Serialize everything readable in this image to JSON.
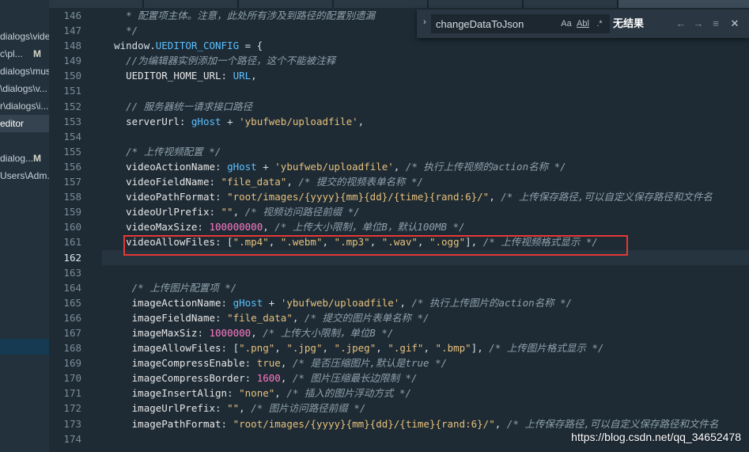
{
  "sidebar": {
    "items": [
      {
        "label": "dialogs\\video",
        "mod": ""
      },
      {
        "label": "c\\pl...",
        "mod": "M"
      },
      {
        "label": "dialogs\\music",
        "mod": ""
      },
      {
        "label": "\\dialogs\\v...",
        "mod": ""
      },
      {
        "label": "r\\dialogs\\i...",
        "mod": ""
      },
      {
        "label": "editor",
        "mod": ""
      },
      {
        "label": "",
        "mod": ""
      },
      {
        "label": "dialog...",
        "mod": "M"
      },
      {
        "label": "Users\\Adm...",
        "mod": ""
      }
    ]
  },
  "find": {
    "query": "changeDataToJson",
    "opt_case": "Aa",
    "opt_word": "Abl",
    "opt_regex": ".*",
    "result": "无结果",
    "prev": "←",
    "next": "→",
    "selection": "≡",
    "close": "✕",
    "toggle": "›"
  },
  "editor": {
    "line_numbers": [
      "146",
      "147",
      "148",
      "149",
      "150",
      "151",
      "152",
      "153",
      "154",
      "155",
      "156",
      "157",
      "158",
      "159",
      "160",
      "161",
      "162",
      "163",
      "164",
      "165",
      "166",
      "167",
      "168",
      "169",
      "170",
      "171",
      "172",
      "173",
      "174"
    ],
    "current_line": "162"
  },
  "code": {
    "l146": "* 配置项主体。注意，此处所有涉及到路径的配置别遗漏",
    "l147": "*/",
    "l148a": "window.",
    "l148b": "UEDITOR_CONFIG",
    "l148c": " = {",
    "l149": "//为编辑器实例添加一个路径，这个不能被注释",
    "l150a": "UEDITOR_HOME_URL",
    "l150b": ": ",
    "l150c": "URL",
    "l150d": ",",
    "l152": "// 服务器统一请求接口路径",
    "l153a": "serverUrl",
    "l153b": ": ",
    "l153c": "gHost",
    "l153d": " + ",
    "l153e": "'ybufweb/uploadfile'",
    "l153f": ",",
    "l155": "/* 上传视频配置 */",
    "l156a": "videoActionName",
    "l156b": ": ",
    "l156c": "gHost",
    "l156d": " + ",
    "l156e": "'ybufweb/uploadfile'",
    "l156f": ", ",
    "l156g": "/* 执行上传视频的action名称 */",
    "l157a": "videoFieldName",
    "l157b": ": ",
    "l157c": "\"file_data\"",
    "l157d": ", ",
    "l157e": "/* 提交的视频表单名称 */",
    "l158a": "videoPathFormat",
    "l158b": ": ",
    "l158c": "\"root/images/{yyyy}{mm}{dd}/{time}{rand:6}/\"",
    "l158d": ", ",
    "l158e": "/* 上传保存路径,可以自定义保存路径和文件名",
    "l159a": "videoUrlPrefix",
    "l159b": ": ",
    "l159c": "\"\"",
    "l159d": ", ",
    "l159e": "/* 视频访问路径前缀 */",
    "l160a": "videoMaxSize",
    "l160b": ": ",
    "l160c": "100000000",
    "l160d": ", ",
    "l160e": "/* 上传大小限制，单位B，默认100MB */",
    "l161a": "videoAllowFiles",
    "l161b": ": [",
    "l161c": "\".mp4\"",
    "l161d": ", ",
    "l161e": "\".webm\"",
    "l161f": ", ",
    "l161g": "\".mp3\"",
    "l161h": ", ",
    "l161i": "\".wav\"",
    "l161j": ", ",
    "l161k": "\".ogg\"",
    "l161l": "], ",
    "l161m": "/* 上传视频格式显示 */",
    "l164": "/* 上传图片配置项 */",
    "l165a": "imageActionName",
    "l165b": ": ",
    "l165c": "gHost",
    "l165d": " + ",
    "l165e": "'ybufweb/uploadfile'",
    "l165f": ", ",
    "l165g": "/* 执行上传图片的action名称 */",
    "l166a": "imageFieldName",
    "l166b": ": ",
    "l166c": "\"file_data\"",
    "l166d": ", ",
    "l166e": "/* 提交的图片表单名称 */",
    "l167a": "imageMaxSiz",
    "l167b": ": ",
    "l167c": "1000000",
    "l167d": ", ",
    "l167e": "/* 上传大小限制，单位B */",
    "l168a": "imageAllowFiles",
    "l168b": ": [",
    "l168c": "\".png\"",
    "l168d": ", ",
    "l168e": "\".jpg\"",
    "l168f": ", ",
    "l168g": "\".jpeg\"",
    "l168h": ", ",
    "l168i": "\".gif\"",
    "l168j": ", ",
    "l168k": "\".bmp\"",
    "l168l": "], ",
    "l168m": "/* 上传图片格式显示 */",
    "l169a": "imageCompressEnable",
    "l169b": ": ",
    "l169c": "true",
    "l169d": ", ",
    "l169e": "/* 是否压缩图片,默认是true */",
    "l170a": "imageCompressBorder",
    "l170b": ": ",
    "l170c": "1600",
    "l170d": ", ",
    "l170e": "/* 图片压缩最长边限制 */",
    "l171a": "imageInsertAlign",
    "l171b": ": ",
    "l171c": "\"none\"",
    "l171d": ", ",
    "l171e": "/* 插入的图片浮动方式 */",
    "l172a": "imageUrlPrefix",
    "l172b": ": ",
    "l172c": "\"\"",
    "l172d": ", ",
    "l172e": "/* 图片访问路径前缀 */",
    "l173a": "imagePathFormat",
    "l173b": ": ",
    "l173c": "\"root/images/{yyyy}{mm}{dd}/{time}{rand:6}/\"",
    "l173d": ", ",
    "l173e": "/* 上传保存路径,可以自定义保存路径和文件名"
  },
  "watermark": "https://blog.csdn.net/qq_34652478",
  "colors": {
    "background": "#1e2b35",
    "sidebar": "#23313c",
    "highlight_box": "#e53935",
    "identifier": "#5bc0ff",
    "string": "#e6c07b",
    "number": "#ff79c6",
    "comment": "#8fa0ab"
  }
}
